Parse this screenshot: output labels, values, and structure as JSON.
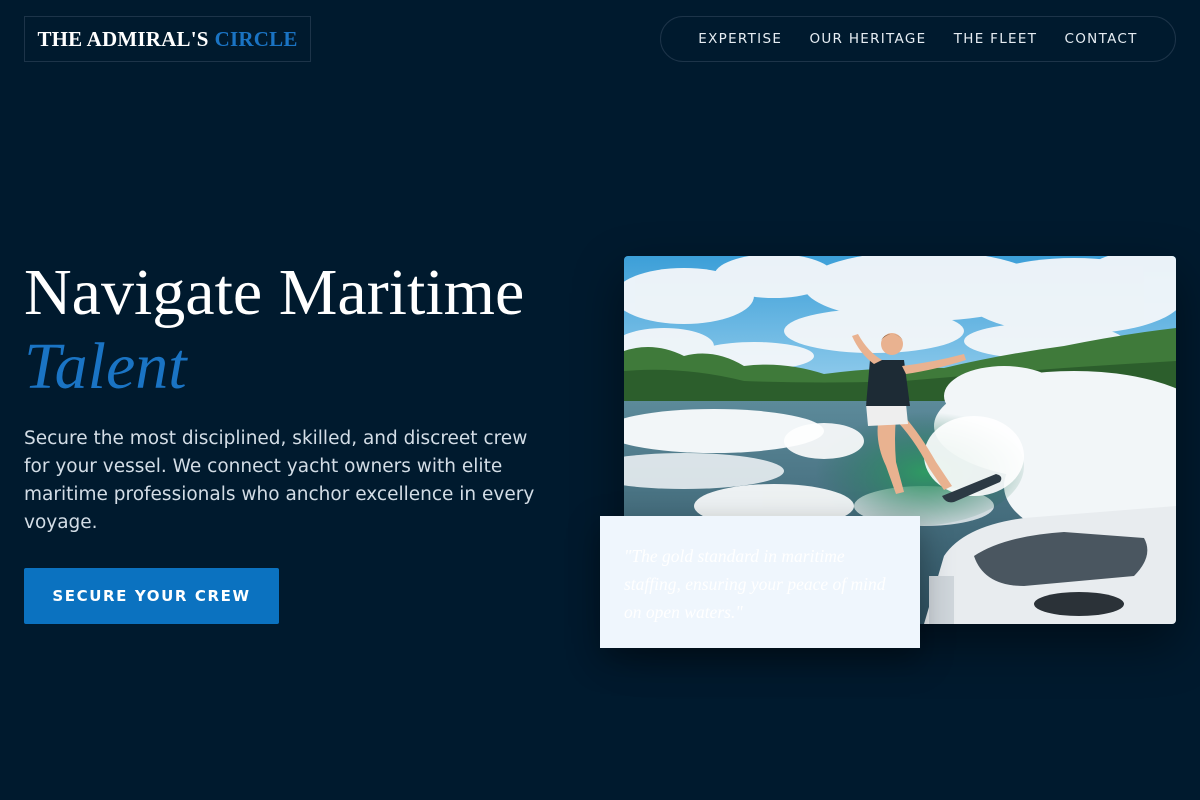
{
  "brand": {
    "name_main": "THE ADMIRAL'S",
    "name_accent": "CIRCLE"
  },
  "nav": {
    "items": [
      {
        "label": "EXPERTISE"
      },
      {
        "label": "OUR HERITAGE"
      },
      {
        "label": "THE FLEET"
      },
      {
        "label": "CONTACT"
      }
    ]
  },
  "hero": {
    "title_line1": "Navigate Maritime",
    "title_line2": "Talent",
    "description": "Secure the most disciplined, skilled, and discreet crew for your vessel. We connect yacht owners with elite maritime professionals who anchor excellence in every voyage.",
    "cta_label": "SECURE YOUR CREW"
  },
  "quote": {
    "text": "\"The gold standard in maritime staffing, ensuring your peace of mind on open waters.\""
  },
  "colors": {
    "background": "#001a2e",
    "accent": "#1a74c4",
    "button": "#0b72c0",
    "card": "#eff6fd"
  }
}
